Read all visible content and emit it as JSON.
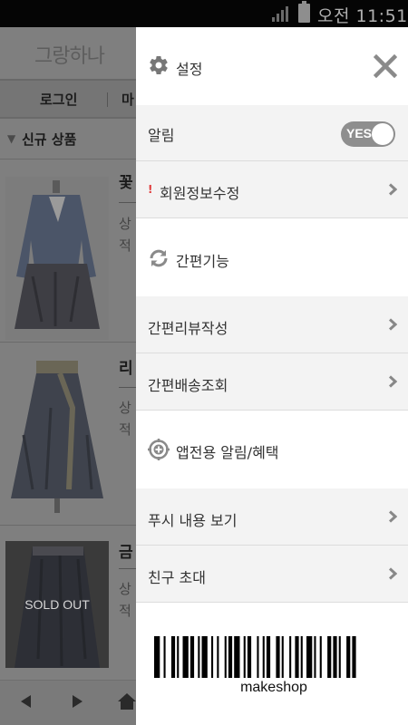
{
  "status_bar": {
    "time": "오전 11:51"
  },
  "background_app": {
    "logo": "그랑하나",
    "nav": {
      "login": "로그인",
      "my": "마"
    },
    "section_title": "신규 상품",
    "products": [
      {
        "name": "꽃",
        "desc": [
          "상",
          "적"
        ]
      },
      {
        "name": "리",
        "desc": [
          "상",
          "적"
        ]
      },
      {
        "name": "금",
        "desc": [
          "상",
          "적"
        ],
        "badge": "SOLD OUT"
      }
    ]
  },
  "drawer": {
    "header": {
      "title": "설정",
      "gear_icon": "gear-icon",
      "close_icon": "close-icon"
    },
    "notification": {
      "label": "알림",
      "toggle_text": "YES",
      "toggle_on": true
    },
    "edit_profile": {
      "label": "회원정보수정",
      "alert_mark": "!"
    },
    "quick_section": {
      "label": "간편기능",
      "icon": "refresh-icon"
    },
    "quick_review": {
      "label": "간편리뷰작성"
    },
    "quick_delivery": {
      "label": "간편배송조회"
    },
    "app_section": {
      "label": "앱전용 알림/혜택",
      "icon": "target-plus-icon"
    },
    "push_view": {
      "label": "푸시 내용 보기"
    },
    "invite": {
      "label": "친구 초대"
    },
    "barcode": {
      "label": "makeshop"
    }
  },
  "colors": {
    "toggle_bg": "#8e8e8e",
    "alert": "#e03b3b",
    "section_bg": "#f3f3f3",
    "overlay": "#7f7f7f"
  }
}
